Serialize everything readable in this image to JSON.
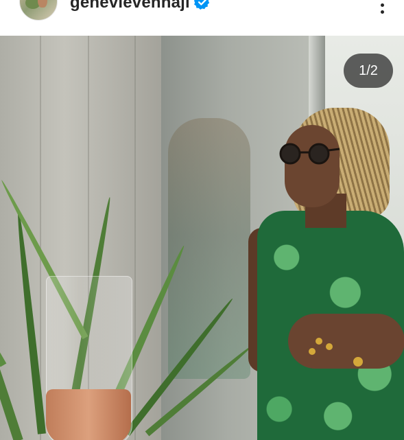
{
  "post_header": {
    "username": "genevievennaji",
    "verified_icon": "verified-badge-icon",
    "more_icon": "more-options-icon"
  },
  "carousel": {
    "counter": "1/2"
  },
  "colors": {
    "verified_blue": "#0095f6",
    "text_dark": "#262626",
    "counter_bg": "#262626"
  }
}
